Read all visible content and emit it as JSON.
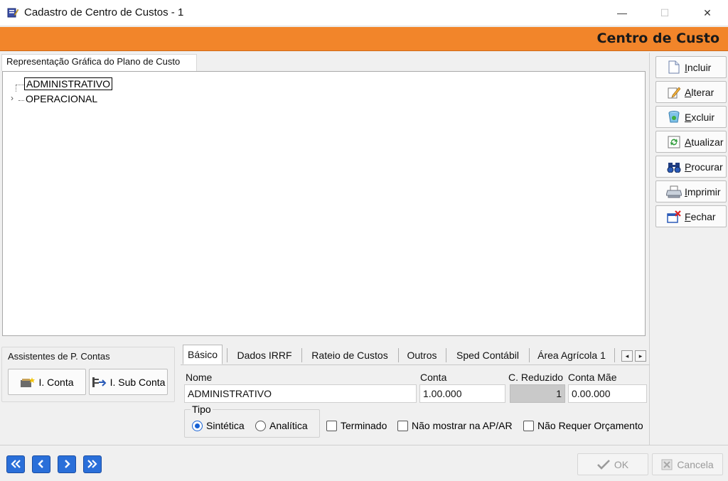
{
  "window": {
    "title": "Cadastro de Centro de Custos - 1",
    "minimize_glyph": "—",
    "maximize_glyph": "☐",
    "close_glyph": "✕"
  },
  "header": {
    "title": "Centro de Custo"
  },
  "tree": {
    "tab_label": "Representação Gráfica do Plano de Custo",
    "nodes": [
      {
        "label": "ADMINISTRATIVO",
        "selected": true,
        "expandable": false
      },
      {
        "label": "OPERACIONAL",
        "selected": false,
        "expandable": true,
        "expander_glyph": "›"
      }
    ]
  },
  "toolbar": {
    "items": [
      {
        "label": "Incluir",
        "icon": "new-document-icon"
      },
      {
        "label": "Alterar",
        "icon": "edit-pencil-icon"
      },
      {
        "label": "Excluir",
        "icon": "recycle-bin-icon"
      },
      {
        "label": "Atualizar",
        "icon": "refresh-icon"
      },
      {
        "label": "Procurar",
        "icon": "binoculars-icon"
      },
      {
        "label": "Imprimir",
        "icon": "printer-icon"
      },
      {
        "label": "Fechar",
        "icon": "close-window-icon"
      }
    ]
  },
  "assistants": {
    "title": "Assistentes de P. Contas",
    "conta_label": "I. Conta",
    "sub_conta_label": "I. Sub Conta"
  },
  "tabs": [
    {
      "label": "Básico",
      "active": true
    },
    {
      "label": "Dados IRRF",
      "active": false
    },
    {
      "label": "Rateio de Custos",
      "active": false
    },
    {
      "label": "Outros",
      "active": false
    },
    {
      "label": "Sped Contábil",
      "active": false
    },
    {
      "label": "Área Agrícola 1",
      "active": false
    }
  ],
  "tab_scroll": {
    "left_glyph": "◂",
    "right_glyph": "▸"
  },
  "form": {
    "nome_label": "Nome",
    "nome_value": "ADMINISTRATIVO",
    "conta_label": "Conta",
    "conta_value": "1.00.000",
    "reduzido_label": "C. Reduzido",
    "reduzido_value": "1",
    "conta_mae_label": "Conta Mãe",
    "conta_mae_value": "0.00.000",
    "tipo_label": "Tipo",
    "tipo_options": [
      {
        "label": "Sintética",
        "selected": true
      },
      {
        "label": "Analítica",
        "selected": false
      }
    ],
    "checkboxes": [
      {
        "label": "Terminado",
        "checked": false
      },
      {
        "label": "Não mostrar na AP/AR",
        "checked": false
      },
      {
        "label": "Não Requer Orçamento",
        "checked": false
      }
    ]
  },
  "footer": {
    "ok_label": "OK",
    "cancel_label": "Cancela"
  },
  "colors": {
    "header_band": "#f2852a",
    "nav_button": "#2a6fd9",
    "radio_selected": "#1560d4"
  }
}
